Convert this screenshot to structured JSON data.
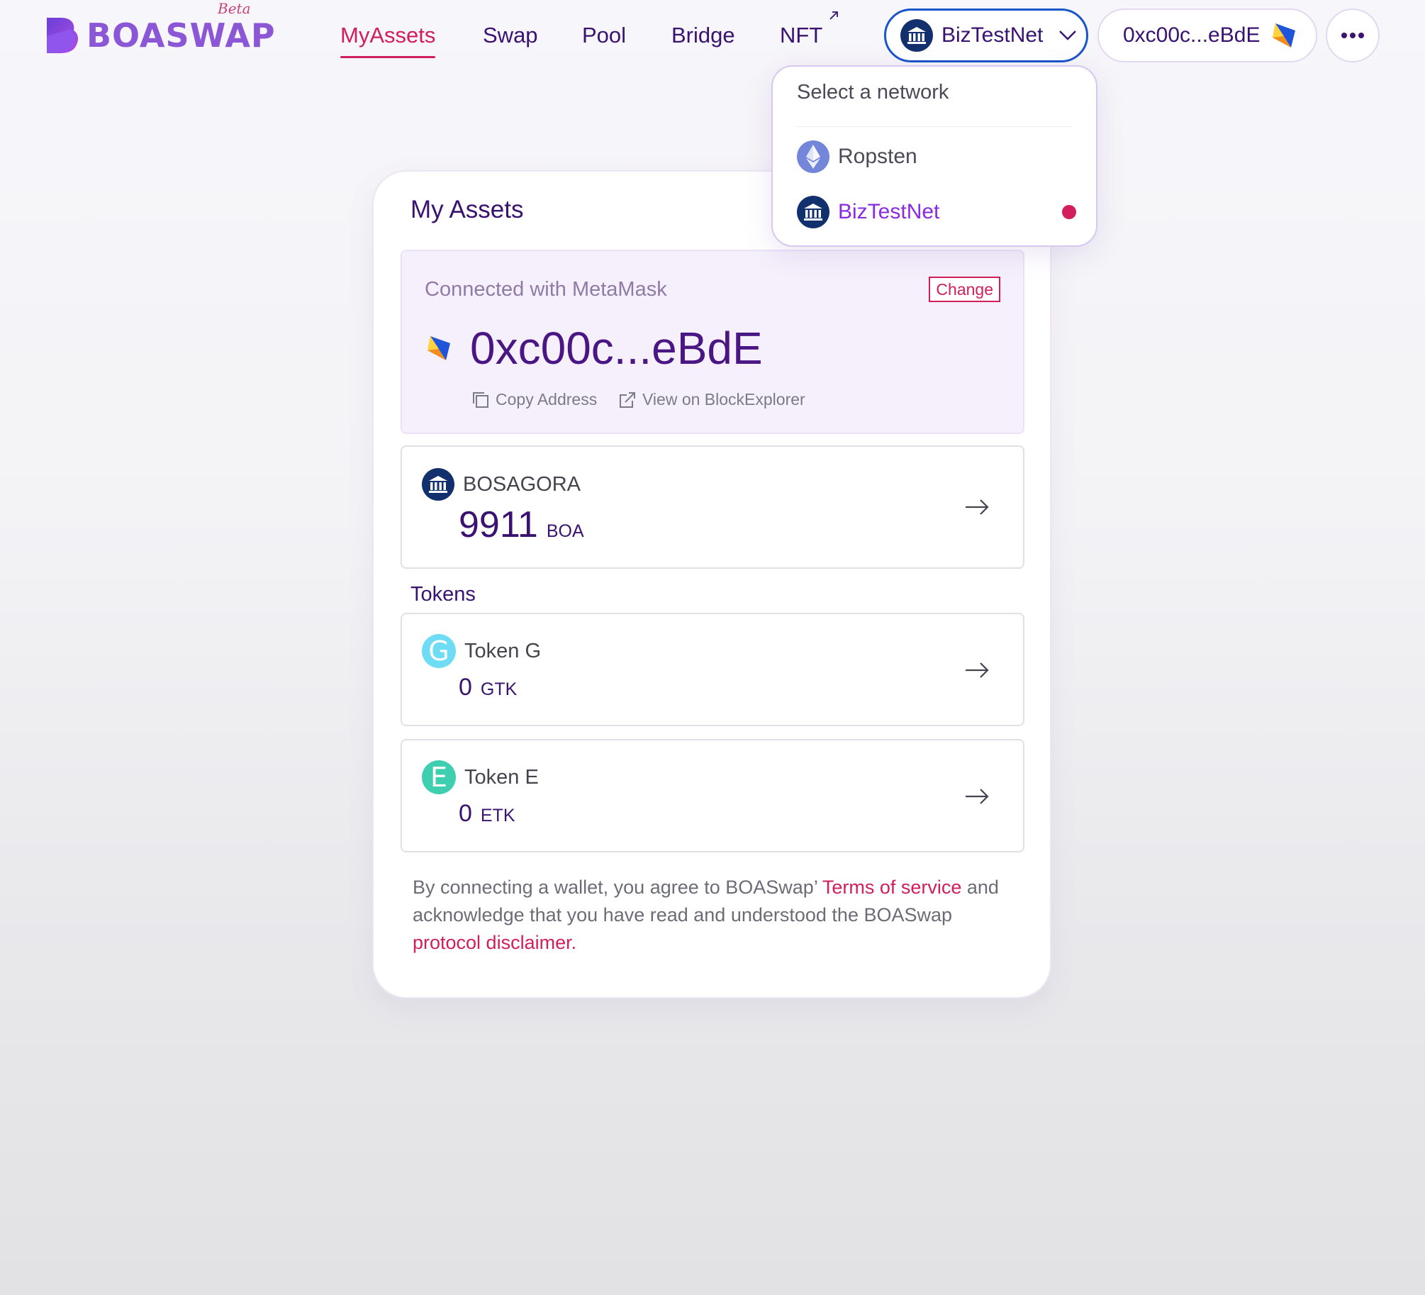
{
  "brand": {
    "name": "BOASWAP",
    "badge": "Beta"
  },
  "nav": {
    "my_assets": "MyAssets",
    "swap": "Swap",
    "pool": "Pool",
    "bridge": "Bridge",
    "nft": "NFT",
    "nft_external_icon": "arrow-up-right-icon",
    "active": "MyAssets"
  },
  "header": {
    "network_label": "BizTestNet",
    "account_label": "0xc00c...eBdE",
    "more_icon": "more-horizontal-icon"
  },
  "network_dropdown": {
    "title": "Select a network",
    "items": [
      {
        "label": "Ropsten",
        "icon": "ethereum-icon",
        "selected": false
      },
      {
        "label": "BizTestNet",
        "icon": "boa-bank-icon",
        "selected": true
      }
    ]
  },
  "my_assets": {
    "title": "My Assets",
    "connected_label": "Connected with MetaMask",
    "change_label": "Change",
    "address": "0xc00c...eBdE",
    "copy_label": "Copy Address",
    "explorer_label": "View on BlockExplorer",
    "native": {
      "name": "BOSAGORA",
      "amount": "9911",
      "symbol": "BOA"
    },
    "tokens_heading": "Tokens",
    "tokens": [
      {
        "letter": "G",
        "name": "Token G",
        "amount": "0",
        "symbol": "GTK",
        "color": "#6fdcf5"
      },
      {
        "letter": "E",
        "name": "Token E",
        "amount": "0",
        "symbol": "ETK",
        "color": "#3ecfb0"
      }
    ]
  },
  "footer": {
    "text_1": "By connecting a wallet, you agree to BOASwap’ ",
    "terms_link": "Terms of service",
    "text_2": " and acknowledge that you have read and understood the BOASwap ",
    "disclaimer_link": "protocol disclaimer."
  },
  "colors": {
    "accent": "#d21e5c",
    "primary_text": "#3a1270",
    "network_border": "#1a55c9",
    "boa_icon_bg": "#13306e",
    "selected_network": "#8a2be2"
  }
}
